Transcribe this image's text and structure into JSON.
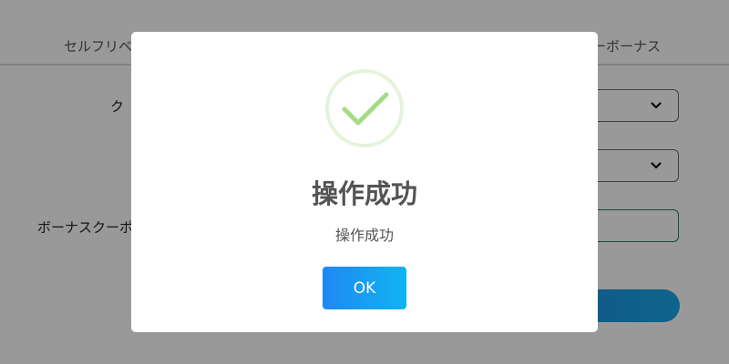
{
  "background": {
    "tabs": {
      "left_label": "セルフリベ",
      "right_label": "ーボーナス"
    },
    "form": {
      "label_1": "ク",
      "label_3": "ボーナスクーポ"
    }
  },
  "modal": {
    "icon": "check-circle-icon",
    "title": "操作成功",
    "message": "操作成功",
    "ok_label": "OK"
  },
  "colors": {
    "success_green": "#a5dc86",
    "button_gradient_start": "#1f88f2",
    "button_gradient_end": "#12b3f2",
    "overlay": "rgba(0,0,0,0.4)"
  }
}
